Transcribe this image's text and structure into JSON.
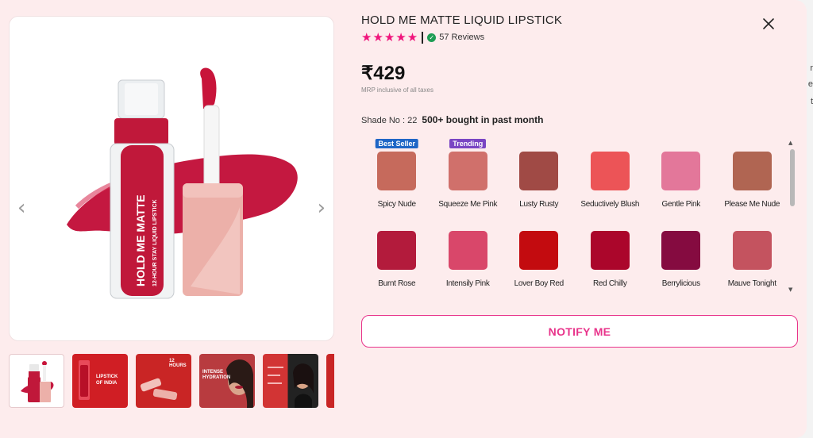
{
  "product": {
    "title": "HOLD ME MATTE LIQUID LIPSTICK",
    "stars": "★★★★★",
    "reviews": "57 Reviews",
    "price": "₹429",
    "mrp_note": "MRP inclusive of all taxes",
    "shade_no": "Shade No : 22",
    "bought": "500+ bought in past month",
    "notify_label": "NOTIFY ME"
  },
  "gallery": {
    "tube_text_1": "HOLD ME MATTE",
    "tube_text_2": "12-HOUR STAY LIQUID LIPSTICK",
    "prev_arrow": "‹",
    "next_arrow": "›",
    "thumbnails": [
      {
        "texts": []
      },
      {
        "texts": [
          "LIPSTICK",
          "OF INDIA"
        ]
      },
      {
        "texts": [
          "12 HOURS"
        ]
      },
      {
        "texts": [
          "INTENSE",
          "HYDRATION"
        ]
      },
      {
        "texts": []
      },
      {
        "texts": []
      }
    ]
  },
  "shades": [
    {
      "name": "Spicy Nude",
      "color": "#c66a5c",
      "badge": "Best Seller",
      "badge_color": "#1f66c6"
    },
    {
      "name": "Squeeze Me Pink",
      "color": "#d0706b",
      "badge": "Trending",
      "badge_color": "#7a45c3"
    },
    {
      "name": "Lusty Rusty",
      "color": "#a04a45",
      "badge": "",
      "badge_color": ""
    },
    {
      "name": "Seductively Blush",
      "color": "#ec5457",
      "badge": "",
      "badge_color": ""
    },
    {
      "name": "Gentle Pink",
      "color": "#e3779a",
      "badge": "",
      "badge_color": ""
    },
    {
      "name": "Please Me Nude",
      "color": "#b06552",
      "badge": "",
      "badge_color": ""
    },
    {
      "name": "Burnt Rose",
      "color": "#b31b3c",
      "badge": "",
      "badge_color": ""
    },
    {
      "name": "Intensily Pink",
      "color": "#d9476a",
      "badge": "",
      "badge_color": ""
    },
    {
      "name": "Lover Boy Red",
      "color": "#c30b0f",
      "badge": "",
      "badge_color": ""
    },
    {
      "name": "Red Chilly",
      "color": "#ab062b",
      "badge": "",
      "badge_color": ""
    },
    {
      "name": "Berrylicious",
      "color": "#850b40",
      "badge": "",
      "badge_color": ""
    },
    {
      "name": "Mauve Tonight",
      "color": "#c4535f",
      "badge": "",
      "badge_color": ""
    }
  ],
  "scroll": {
    "up": "▲",
    "down": "▼"
  },
  "backdrop": {
    "a": "r",
    "b": "e",
    "c": "t"
  },
  "icons": {
    "close": "close-icon",
    "verified": "check-circle-icon",
    "star": "star-icon"
  },
  "colors": {
    "accent": "#e8338a",
    "stars": "#f0157c",
    "product_red": "#c0183a",
    "modal_bg": "#fdeced"
  }
}
